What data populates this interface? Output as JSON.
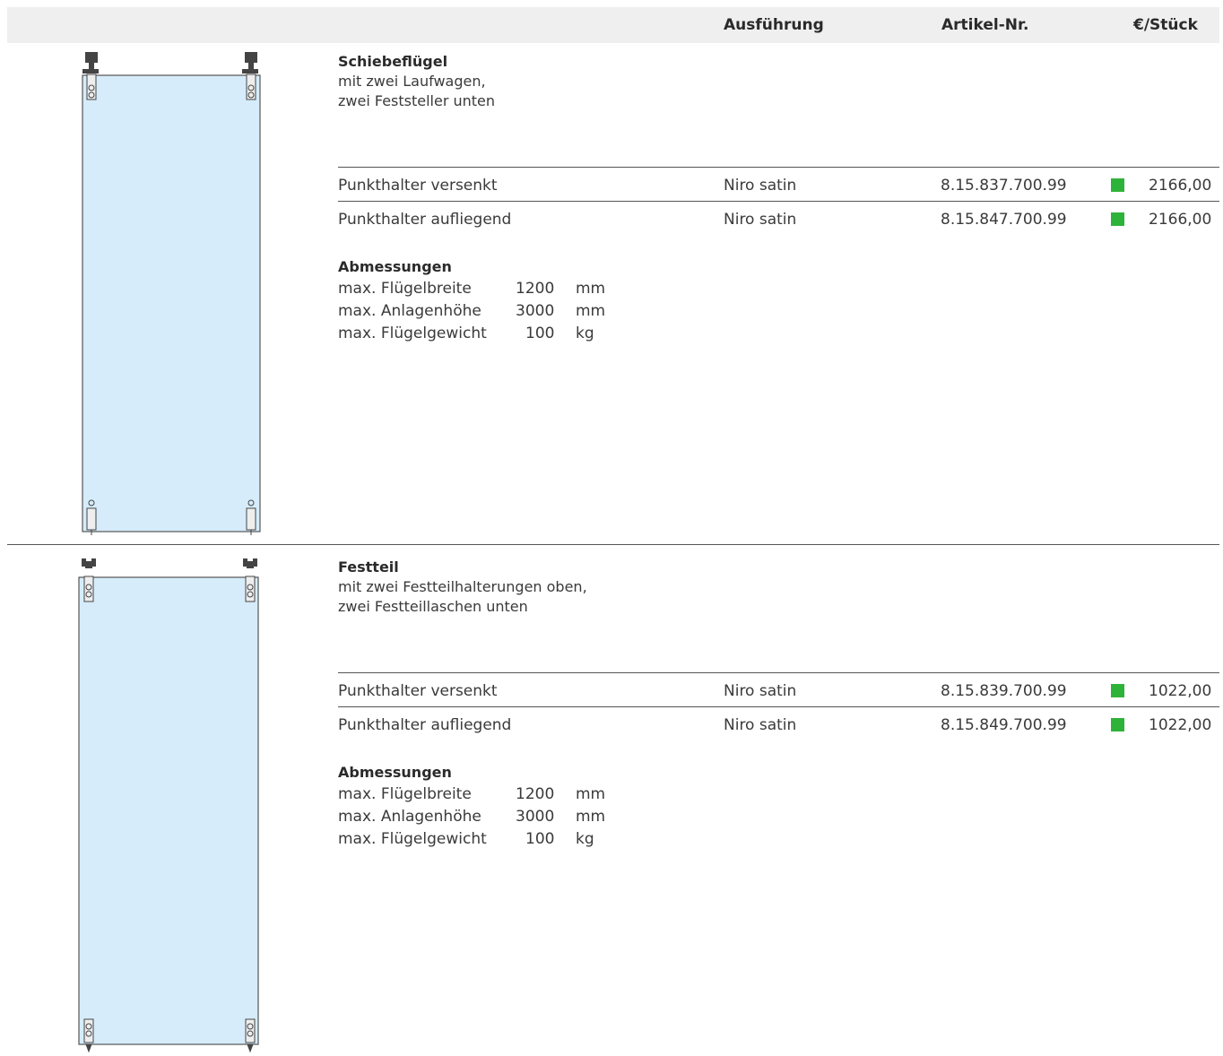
{
  "header": {
    "col_ausfuehrung": "Ausführung",
    "col_artikel": "Artikel-Nr.",
    "col_preis": "€/Stück"
  },
  "sections": [
    {
      "title": "Schiebeflügel",
      "desc_line1": "mit zwei Laufwagen,",
      "desc_line2": "zwei Feststeller unten",
      "illustration": "sliding-panel-with-two-carriages-icon",
      "rows": [
        {
          "name": "Punkthalter versenkt",
          "finish": "Niro satin",
          "article": "8.15.837.700.99",
          "price": "2166,00"
        },
        {
          "name": "Punkthalter aufliegend",
          "finish": "Niro satin",
          "article": "8.15.847.700.99",
          "price": "2166,00"
        }
      ],
      "dims_title": "Abmessungen",
      "dims": [
        {
          "label": "max. Flügelbreite",
          "value": "1200",
          "unit": "mm"
        },
        {
          "label": "max. Anlagenhöhe",
          "value": "3000",
          "unit": "mm"
        },
        {
          "label": "max. Flügelgewicht",
          "value": "100",
          "unit": "kg"
        }
      ]
    },
    {
      "title": "Festteil",
      "desc_line1": "mit zwei Festteilhalterungen oben,",
      "desc_line2": "zwei Festteillaschen unten",
      "illustration": "fixed-panel-with-holders-icon",
      "rows": [
        {
          "name": "Punkthalter versenkt",
          "finish": "Niro satin",
          "article": "8.15.839.700.99",
          "price": "1022,00"
        },
        {
          "name": "Punkthalter aufliegend",
          "finish": "Niro satin",
          "article": "8.15.849.700.99",
          "price": "1022,00"
        }
      ],
      "dims_title": "Abmessungen",
      "dims": [
        {
          "label": "max. Flügelbreite",
          "value": "1200",
          "unit": "mm"
        },
        {
          "label": "max. Anlagenhöhe",
          "value": "3000",
          "unit": "mm"
        },
        {
          "label": "max. Flügelgewicht",
          "value": "100",
          "unit": "kg"
        }
      ]
    }
  ],
  "colors": {
    "header_bg": "#efefef",
    "glass": "#d6ecfb",
    "availability": "#2eb33a"
  }
}
